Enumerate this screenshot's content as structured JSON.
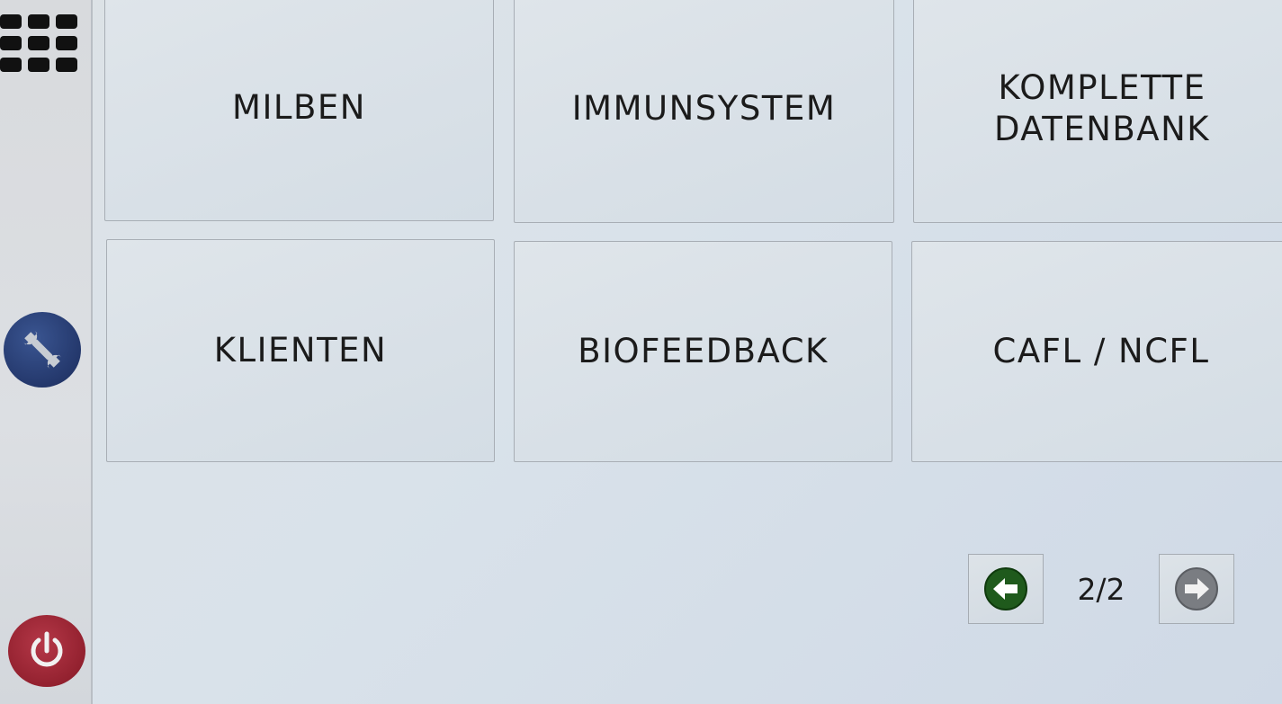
{
  "sidebar": {
    "menu_icon": "grid-menu-icon",
    "tools_icon": "wrench-icon",
    "power_icon": "power-icon",
    "colors": {
      "tools": "#24386c",
      "power": "#93212f"
    }
  },
  "tiles": [
    {
      "label": "MILBEN"
    },
    {
      "label": "IMMUNSYSTEM"
    },
    {
      "label": "KOMPLETTE\nDATENBANK"
    },
    {
      "label": "KLIENTEN"
    },
    {
      "label": "BIOFEEDBACK"
    },
    {
      "label": "CAFL / NCFL"
    }
  ],
  "pagination": {
    "current": "2/2",
    "prev_icon": "arrow-left-icon",
    "next_icon": "arrow-right-icon",
    "prev_color": "#1f5a1c",
    "next_color": "#7a7d82"
  }
}
